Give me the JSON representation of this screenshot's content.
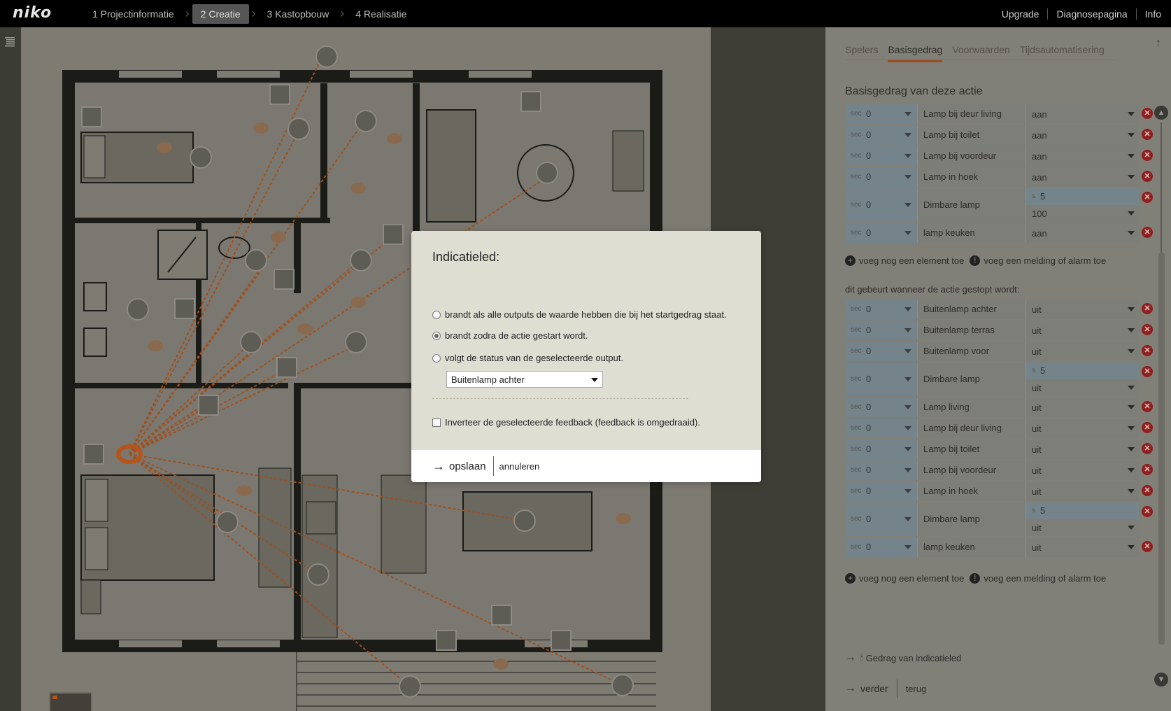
{
  "brand": {
    "logo": "niko"
  },
  "steps": [
    {
      "label": "1 Projectinformatie",
      "active": false
    },
    {
      "label": "2 Creatie",
      "active": true
    },
    {
      "label": "3 Kastopbouw",
      "active": false
    },
    {
      "label": "4 Realisatie",
      "active": false
    }
  ],
  "toplinks": [
    "Upgrade",
    "Diagnosepagina",
    "Info"
  ],
  "panel": {
    "tabs": [
      {
        "label": "Spelers",
        "active": false
      },
      {
        "label": "Basisgedrag",
        "active": true
      },
      {
        "label": "Voorwaarden",
        "active": false
      },
      {
        "label": "Tijdsautomatisering",
        "active": false
      }
    ],
    "section_title": "Basisgedrag van deze actie",
    "sec_unit": "sec",
    "s_unit": "s",
    "start_rows": [
      {
        "sec": "0",
        "name": "Lamp bij deur living",
        "value": "aan"
      },
      {
        "sec": "0",
        "name": "Lamp bij toilet",
        "value": "aan"
      },
      {
        "sec": "0",
        "name": "Lamp bij voordeur",
        "value": "aan"
      },
      {
        "sec": "0",
        "name": "Lamp in hoek",
        "value": "aan"
      },
      {
        "sec": "0",
        "name": "Dimbare lamp",
        "time": "5",
        "value": "100",
        "tall": true
      },
      {
        "sec": "0",
        "name": "lamp keuken",
        "value": "aan"
      }
    ],
    "add_element": "voeg nog een element toe",
    "add_alarm": "voeg een melding of alarm toe",
    "stop_title": "dit gebeurt wanneer de actie gestopt wordt:",
    "stop_rows": [
      {
        "sec": "0",
        "name": "Buitenlamp achter",
        "value": "uit"
      },
      {
        "sec": "0",
        "name": "Buitenlamp terras",
        "value": "uit"
      },
      {
        "sec": "0",
        "name": "Buitenlamp voor",
        "value": "uit"
      },
      {
        "sec": "0",
        "name": "Dimbare lamp",
        "time": "5",
        "value": "uit",
        "tall": true
      },
      {
        "sec": "0",
        "name": "Lamp living",
        "value": "uit"
      },
      {
        "sec": "0",
        "name": "Lamp bij deur living",
        "value": "uit"
      },
      {
        "sec": "0",
        "name": "Lamp bij toilet",
        "value": "uit"
      },
      {
        "sec": "0",
        "name": "Lamp bij voordeur",
        "value": "uit"
      },
      {
        "sec": "0",
        "name": "Lamp in hoek",
        "value": "uit"
      },
      {
        "sec": "0",
        "name": "Dimbare lamp",
        "time": "5",
        "value": "uit",
        "tall": true
      },
      {
        "sec": "0",
        "name": "lamp keuken",
        "value": "uit"
      }
    ],
    "indicator_link": "Gedrag van indicatieled",
    "next": "verder",
    "back": "terug"
  },
  "modal": {
    "title": "Indicatieled:",
    "options": [
      {
        "label": "brandt als alle outputs de waarde hebben die bij het startgedrag staat.",
        "checked": false
      },
      {
        "label": "brandt zodra de actie gestart wordt.",
        "checked": true
      },
      {
        "label": "volgt de status van de geselecteerde output.",
        "checked": false
      }
    ],
    "select_value": "Buitenlamp achter",
    "invert_label": "Inverteer de geselecteerde feedback (feedback is omgedraaid).",
    "save": "opslaan",
    "cancel": "annuleren"
  },
  "colors": {
    "accent": "#b5541b",
    "delete": "#8f2020",
    "topbar": "#000000",
    "overlay_canvas": "#7d7b72"
  }
}
